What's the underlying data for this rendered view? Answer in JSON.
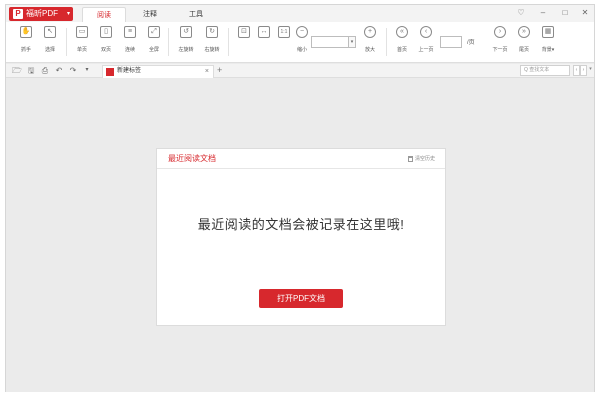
{
  "app": {
    "name": "福昕PDF",
    "caret": "▾",
    "logo": "P",
    "brand_color": "#d7282d"
  },
  "menu": {
    "tabs": [
      {
        "label": "阅读",
        "active": true
      },
      {
        "label": "注释",
        "active": false
      },
      {
        "label": "工具",
        "active": false
      }
    ]
  },
  "window_controls": {
    "pin": "♡",
    "minimize": "–",
    "maximize": "□",
    "close": "✕"
  },
  "ribbon": {
    "hand": {
      "label": "抓手",
      "icon": "hand-icon",
      "glyph": "✋"
    },
    "select": {
      "label": "选择",
      "icon": "cursor-icon",
      "glyph": "↖"
    },
    "single_page": {
      "label": "单页",
      "icon": "single-page-icon",
      "glyph": "▭"
    },
    "double_page": {
      "label": "双页",
      "icon": "double-page-icon",
      "glyph": "▯"
    },
    "continuous": {
      "label": "连续",
      "icon": "continuous-icon",
      "glyph": "≡"
    },
    "fullscreen": {
      "label": "全屏",
      "icon": "fullscreen-icon",
      "glyph": "⤢"
    },
    "rotate_left": {
      "label": "左旋转",
      "icon": "rotate-left-icon",
      "glyph": "↺"
    },
    "rotate_right": {
      "label": "右旋转",
      "icon": "rotate-right-icon",
      "glyph": "↻"
    },
    "fit_page": {
      "label": "",
      "icon": "fit-page-icon",
      "glyph": "⊡"
    },
    "fit_width": {
      "label": "",
      "icon": "fit-width-icon",
      "glyph": "↔"
    },
    "actual_size": {
      "label": "",
      "icon": "actual-size-icon",
      "glyph": "1:1"
    },
    "zoom_out": {
      "label": "缩小",
      "icon": "zoom-out-icon",
      "glyph": "−"
    },
    "zoom_value": "",
    "zoom_in": {
      "label": "放大",
      "icon": "zoom-in-icon",
      "glyph": "+"
    },
    "first_page": {
      "label": "首页",
      "icon": "first-page-icon",
      "glyph": "«"
    },
    "prev_page": {
      "label": "上一页",
      "icon": "prev-page-icon",
      "glyph": "‹"
    },
    "page_value": "",
    "page_total": "/页",
    "next_page": {
      "label": "下一页",
      "icon": "next-page-icon",
      "glyph": "›"
    },
    "last_page": {
      "label": "尾页",
      "icon": "last-page-icon",
      "glyph": "»"
    },
    "background": {
      "label": "背景▾",
      "icon": "background-icon",
      "glyph": "▦"
    }
  },
  "quick_access": {
    "open": "🗁",
    "save": "🖫",
    "print": "⎙",
    "undo": "↶",
    "redo": "↷",
    "more": "▾"
  },
  "doc_tab": {
    "label": "新建标签",
    "close": "×",
    "add": "+"
  },
  "search": {
    "placeholder": "Q 查找文本",
    "prev": "‹",
    "next": "›",
    "more": "▾"
  },
  "recent": {
    "title": "最近阅读文档",
    "clear_label": "清空历史",
    "empty_message": "最近阅读的文档会被记录在这里哦!",
    "open_button": "打开PDF文档"
  }
}
